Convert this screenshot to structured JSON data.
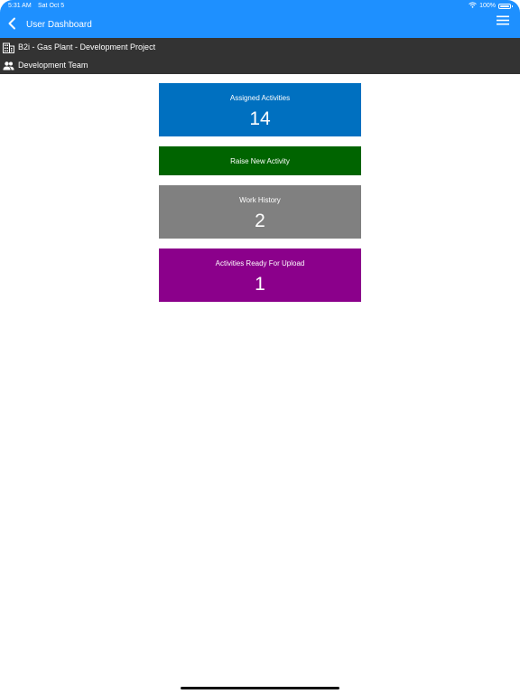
{
  "status_bar": {
    "time": "5:31 AM",
    "date": "Sat Oct 5",
    "battery": "100%",
    "wifi_icon": "wifi-icon",
    "battery_icon": "battery-icon"
  },
  "nav": {
    "back_icon": "chevron-left-icon",
    "title": "User Dashboard",
    "menu_icon": "hamburger-menu-icon",
    "color": "#1e90ff"
  },
  "info": {
    "project_icon": "building-icon",
    "project": "B2i - Gas Plant - Development Project",
    "team_icon": "people-icon",
    "team": "Development Team"
  },
  "tiles": {
    "assigned": {
      "label": "Assigned Activities",
      "value": "14",
      "color": "#0070c0"
    },
    "raise": {
      "label": "Raise New Activity",
      "color": "#006400"
    },
    "history": {
      "label": "Work History",
      "value": "2",
      "color": "#808080"
    },
    "upload": {
      "label": "Activities Ready For Upload",
      "value": "1",
      "color": "#8b008b"
    }
  }
}
